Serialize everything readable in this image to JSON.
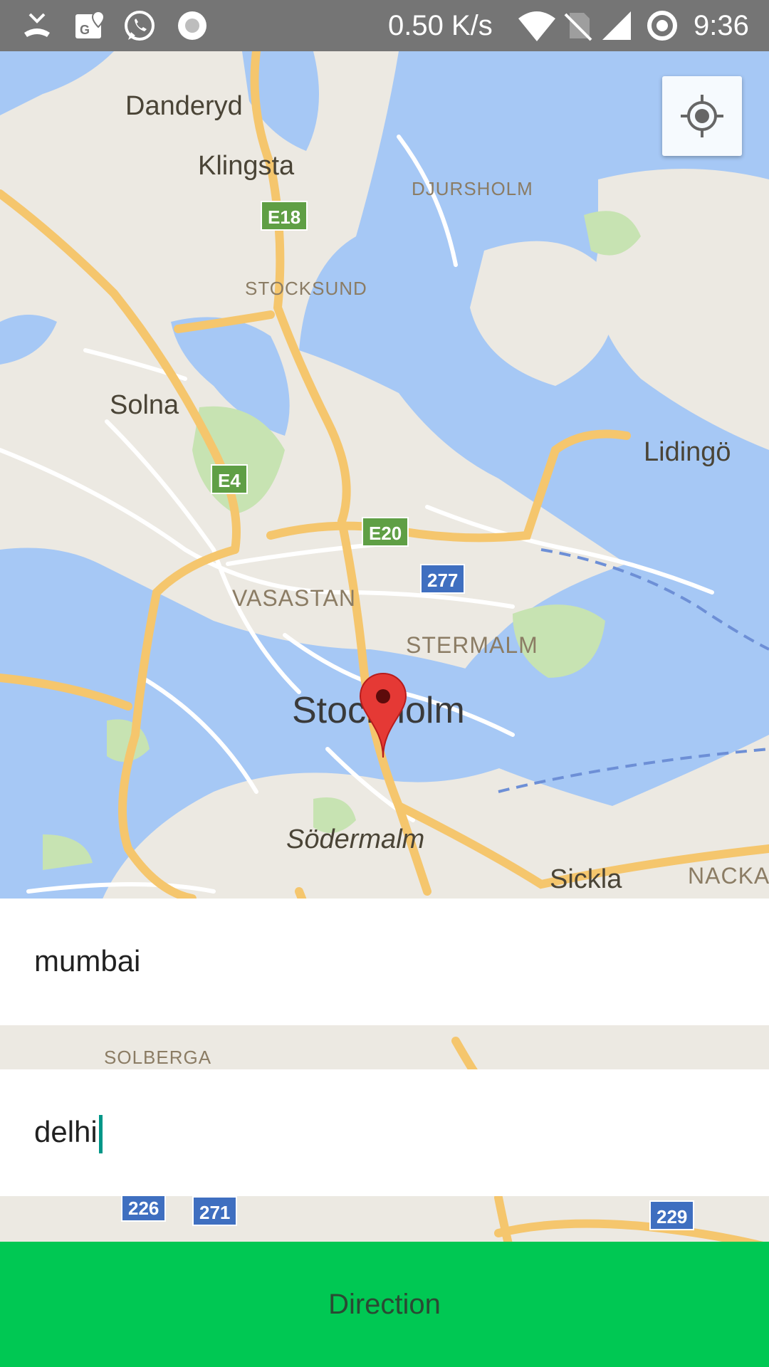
{
  "status_bar": {
    "network_speed": "0.50 K/s",
    "time": "9:36",
    "icons": [
      "missed-call-icon",
      "maps-notification-icon",
      "whatsapp-icon",
      "record-icon",
      "wifi-icon",
      "no-sim-icon",
      "signal-icon",
      "hotspot-icon"
    ]
  },
  "map": {
    "labels": {
      "danderyd": "Danderyd",
      "klingsta": "Klingsta",
      "djursholm": "DJURSHOLM",
      "stocksund": "STOCKSUND",
      "solna": "Solna",
      "lidingo": "Lidingö",
      "vasastan": "VASASTAN",
      "ostermalm": "STERMALM",
      "stockholm": "Stockholm",
      "sodermalm": "Södermalm",
      "sickla": "Sickla",
      "nacka": "NACKA",
      "solberga": "SOLBERGA"
    },
    "shields": {
      "e18": "E18",
      "e4": "E4",
      "e20": "E20",
      "r277": "277",
      "r226": "226",
      "r271": "271",
      "r229": "229"
    },
    "colors": {
      "water": "#a6c8f5",
      "land": "#ece9e2",
      "park": "#c7e3b2",
      "road": "#f5c66d"
    }
  },
  "route_form": {
    "origin_value": "mumbai",
    "destination_value": "delhi"
  },
  "direction_button": {
    "label": "Direction",
    "color": "#00c853"
  }
}
